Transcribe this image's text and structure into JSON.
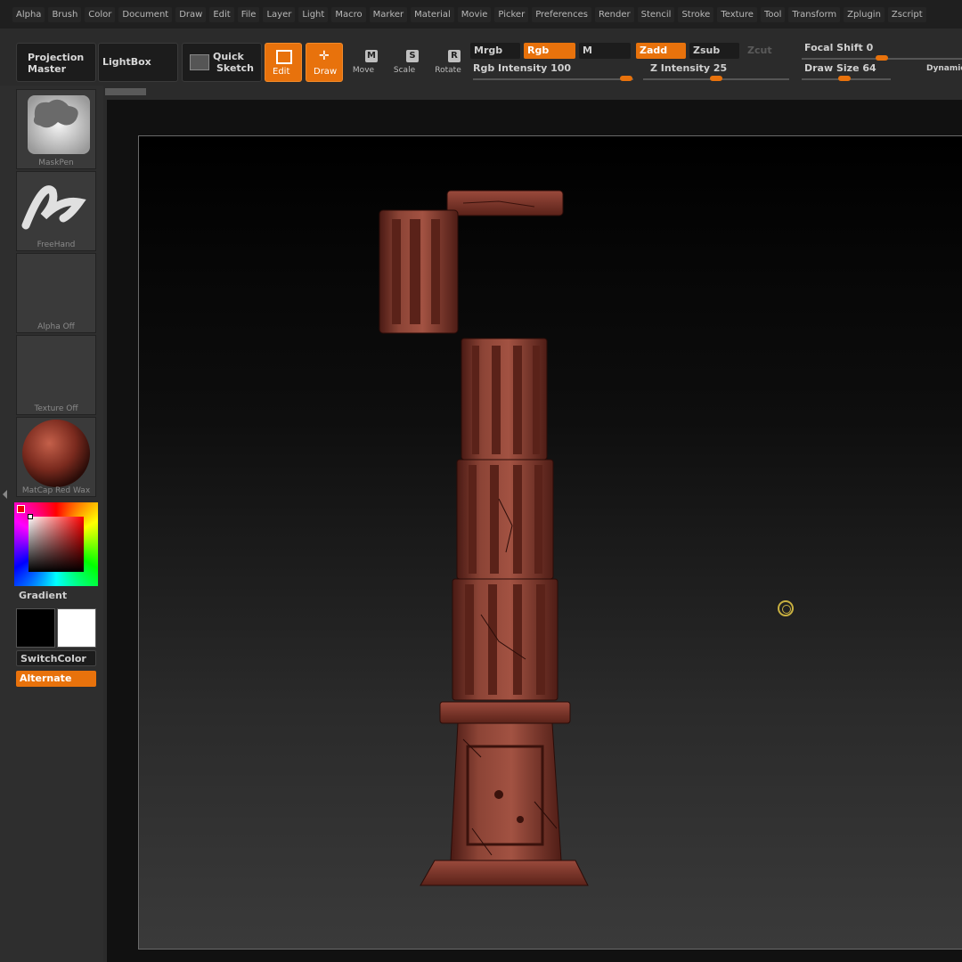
{
  "menu": [
    "Alpha",
    "Brush",
    "Color",
    "Document",
    "Draw",
    "Edit",
    "File",
    "Layer",
    "Light",
    "Macro",
    "Marker",
    "Material",
    "Movie",
    "Picker",
    "Preferences",
    "Render",
    "Stencil",
    "Stroke",
    "Texture",
    "Tool",
    "Transform",
    "Zplugin",
    "Zscript"
  ],
  "toolbar": {
    "projection_master_1": "Projection",
    "projection_master_2": "Master",
    "lightbox": "LightBox",
    "quick_sketch_1": "Quick",
    "quick_sketch_2": "Sketch",
    "edit": "Edit",
    "draw": "Draw",
    "move": "Move",
    "scale": "Scale",
    "rotate": "Rotate",
    "move_glyph": "M",
    "scale_glyph": "S",
    "rotate_glyph": "R",
    "mrgb": "Mrgb",
    "rgb": "Rgb",
    "m": "M",
    "zadd": "Zadd",
    "zsub": "Zsub",
    "zcut": "Zcut",
    "rgb_intensity_label": "Rgb Intensity",
    "rgb_intensity_value": "100",
    "z_intensity_label": "Z Intensity",
    "z_intensity_value": "25",
    "focal_shift_label": "Focal Shift",
    "focal_shift_value": "0",
    "draw_size_label": "Draw Size",
    "draw_size_value": "64",
    "dynamic": "Dynamic"
  },
  "shelf": {
    "brush": "MaskPen",
    "stroke": "FreeHand",
    "alpha": "Alpha Off",
    "texture": "Texture Off",
    "material": "MatCap Red Wax",
    "gradient": "Gradient",
    "switch_color": "SwitchColor",
    "alternate": "Alternate"
  },
  "colors": {
    "accent": "#e8720c",
    "model": "#7a3a2e",
    "cursor": "#c8b040"
  }
}
